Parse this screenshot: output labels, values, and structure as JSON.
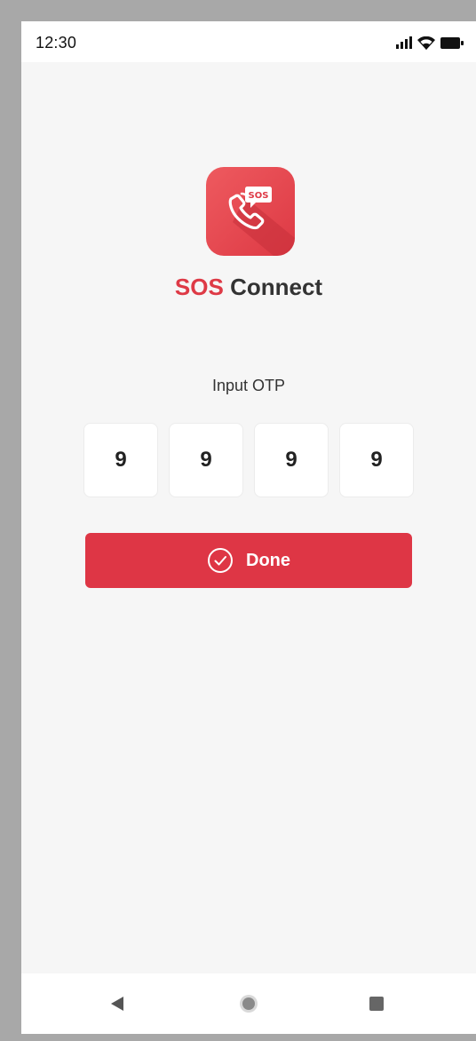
{
  "status_bar": {
    "time": "12:30",
    "icons": [
      "signal-icon",
      "wifi-icon",
      "battery-icon"
    ]
  },
  "app": {
    "logo_icon": "phone-sos-icon",
    "logo_text": "SOS",
    "name_brand": "SOS",
    "name_rest": " Connect",
    "brand_color": "#de3a46"
  },
  "otp": {
    "label": "Input OTP",
    "digits": [
      "9",
      "9",
      "9",
      "9"
    ]
  },
  "done_button": {
    "label": "Done",
    "icon": "check-circle-icon",
    "color": "#de3645"
  },
  "nav_bar": {
    "buttons": [
      "back-icon",
      "home-icon",
      "recents-icon"
    ]
  }
}
